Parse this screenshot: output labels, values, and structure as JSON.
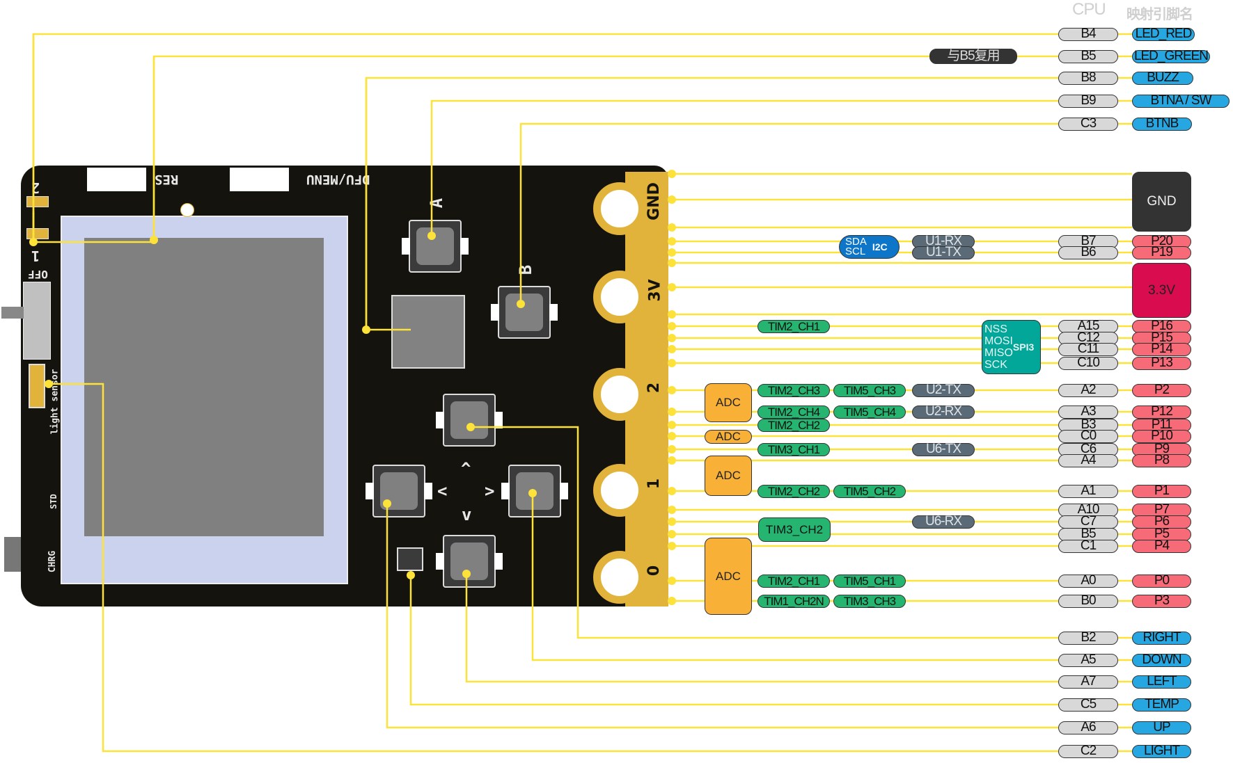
{
  "headers": {
    "cpu": "CPU",
    "mapped": "映射引脚名"
  },
  "board": {
    "silk_res": "RES",
    "silk_dfu_menu": "DFU/MENU",
    "silk_off": "OFF",
    "silk_light_sensor": "light sensor",
    "silk_std": "STD",
    "silk_chrg": "CHRG",
    "silk_1": "1",
    "silk_2": "2",
    "btn_a": "A",
    "btn_b": "B",
    "arrow_up": "^",
    "arrow_down": "v",
    "arrow_left": "<",
    "arrow_right": ">",
    "edge_gnd": "GND",
    "edge_3v": "3V",
    "edge_2": "2",
    "edge_1": "1",
    "edge_0": "0"
  },
  "top_signals": [
    {
      "cpu": "B4",
      "func": "LED_RED"
    },
    {
      "cpu": "B5",
      "func": "LED_GREEN",
      "note": "与B5复用"
    },
    {
      "cpu": "B8",
      "func": "BUZZ"
    },
    {
      "cpu": "B9",
      "func": "BTNA / SW"
    },
    {
      "cpu": "C3",
      "func": "BTNB"
    }
  ],
  "power": {
    "gnd": "GND",
    "v33": "3.3V"
  },
  "edge_pins": [
    {
      "cpu": "B7",
      "pin": "P20",
      "uart": "U1-RX"
    },
    {
      "cpu": "B6",
      "pin": "P19",
      "uart": "U1-TX"
    },
    {
      "cpu": "A15",
      "pin": "P16",
      "tim": [
        "TIM2_CH1"
      ]
    },
    {
      "cpu": "C12",
      "pin": "P15"
    },
    {
      "cpu": "C11",
      "pin": "P14"
    },
    {
      "cpu": "C10",
      "pin": "P13"
    },
    {
      "cpu": "A2",
      "pin": "P2",
      "tim": [
        "TIM2_CH3",
        "TIM5_CH3"
      ],
      "uart": "U2-TX"
    },
    {
      "cpu": "A3",
      "pin": "P12",
      "tim": [
        "TIM2_CH4",
        "TIM5_CH4"
      ],
      "uart": "U2-RX"
    },
    {
      "cpu": "B3",
      "pin": "P11",
      "tim": [
        "TIM2_CH2"
      ]
    },
    {
      "cpu": "C0",
      "pin": "P10"
    },
    {
      "cpu": "C6",
      "pin": "P9",
      "tim": [
        "TIM3_CH1"
      ],
      "uart": "U6-TX"
    },
    {
      "cpu": "A4",
      "pin": "P8"
    },
    {
      "cpu": "A1",
      "pin": "P1",
      "tim": [
        "TIM2_CH2",
        "TIM5_CH2"
      ]
    },
    {
      "cpu": "A10",
      "pin": "P7"
    },
    {
      "cpu": "C7",
      "pin": "P6",
      "uart": "U6-RX"
    },
    {
      "cpu": "B5",
      "pin": "P5"
    },
    {
      "cpu": "C1",
      "pin": "P4"
    },
    {
      "cpu": "A0",
      "pin": "P0",
      "tim": [
        "TIM2_CH1",
        "TIM5_CH1"
      ]
    },
    {
      "cpu": "B0",
      "pin": "P3",
      "tim": [
        "TIM1_CH2N",
        "TIM3_CH3"
      ]
    }
  ],
  "i2c": {
    "sda": "SDA",
    "scl": "SCL",
    "label": "I2C"
  },
  "spi": {
    "nss": "NSS",
    "mosi": "MOSI",
    "miso": "MISO",
    "sck": "SCK",
    "label": "SPI3"
  },
  "tim3_ch2": "TIM3_CH2",
  "adc_label": "ADC",
  "bottom_signals": [
    {
      "cpu": "B2",
      "func": "RIGHT"
    },
    {
      "cpu": "A5",
      "func": "DOWN"
    },
    {
      "cpu": "A7",
      "func": "LEFT"
    },
    {
      "cpu": "C5",
      "func": "TEMP"
    },
    {
      "cpu": "A6",
      "func": "UP"
    },
    {
      "cpu": "C2",
      "func": "LIGHT"
    }
  ],
  "colors": {
    "wire": "#fde23a",
    "cpu_pill": "#d8d8d8",
    "pin_pill": "#f76a78",
    "func_pill": "#27a7e1",
    "timer": "#25b571",
    "uart": "#5a6a76",
    "adc": "#f9b036",
    "gnd": "#333333",
    "v33": "#d80c4f",
    "i2c": "#0d76c8",
    "spi": "#03a79a"
  }
}
